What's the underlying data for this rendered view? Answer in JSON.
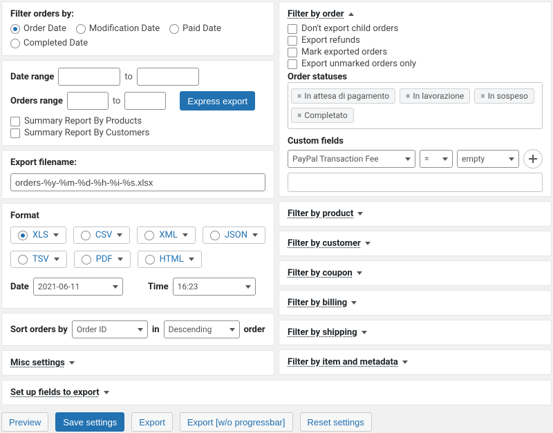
{
  "left": {
    "filter_by_label": "Filter orders by:",
    "radios": [
      "Order Date",
      "Modification Date",
      "Paid Date",
      "Completed Date"
    ],
    "selected_radio": 0,
    "date_range_label": "Date range",
    "to": "to",
    "orders_range_label": "Orders range",
    "express_export": "Express export",
    "summary_products": "Summary Report By Products",
    "summary_customers": "Summary Report By Customers",
    "export_filename_label": "Export filename:",
    "export_filename_value": "orders-%y-%m-%d-%h-%i-%s.xlsx",
    "format_label": "Format",
    "formats": [
      "XLS",
      "CSV",
      "XML",
      "JSON",
      "TSV",
      "PDF",
      "HTML"
    ],
    "selected_format": 0,
    "date_label": "Date",
    "date_value": "2021-06-11",
    "time_label": "Time",
    "time_value": "16:23",
    "sort_label": "Sort orders by",
    "sort_field": "Order ID",
    "in": "in",
    "sort_dir": "Descending",
    "order_word": "order",
    "misc_settings": "Misc settings"
  },
  "right": {
    "filter_by_order": "Filter by order",
    "checks": [
      "Don't export child orders",
      "Export refunds",
      "Mark exported orders",
      "Export unmarked orders only"
    ],
    "order_statuses_label": "Order statuses",
    "status_tags": [
      "In attesa di pagamento",
      "In lavorazione",
      "In sospeso",
      "Completato"
    ],
    "custom_fields_label": "Custom fields",
    "cf_field": "PayPal Transaction Fee",
    "cf_op": "=",
    "cf_val": "empty",
    "filters": [
      "Filter by product",
      "Filter by customer",
      "Filter by coupon",
      "Filter by billing",
      "Filter by shipping",
      "Filter by item and metadata"
    ]
  },
  "bottom": {
    "setup_fields": "Set up fields to export"
  },
  "footer": {
    "preview": "Preview",
    "save": "Save settings",
    "export": "Export",
    "export_noprog": "Export [w/o progressbar]",
    "reset": "Reset settings"
  }
}
